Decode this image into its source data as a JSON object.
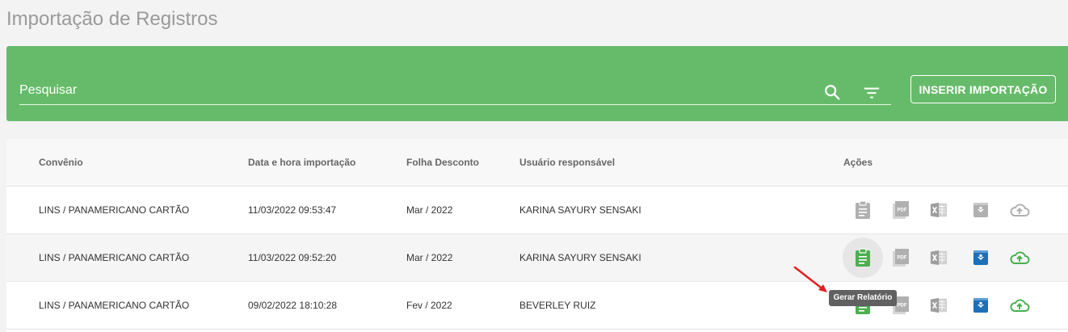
{
  "page": {
    "title": "Importação de Registros"
  },
  "toolbar": {
    "search_placeholder": "Pesquisar",
    "insert_label": "INSERIR IMPORTAÇÃO"
  },
  "table": {
    "headers": {
      "convenio": "Convênio",
      "data_hora": "Data e hora importação",
      "folha": "Folha Desconto",
      "usuario": "Usuário responsável",
      "acoes": "Ações"
    },
    "rows": [
      {
        "convenio": "LINS / PANAMERICANO CARTÃO",
        "data_hora": "11/03/2022 09:53:47",
        "folha": "Mar / 2022",
        "usuario": "KARINA SAYURY SENSAKI"
      },
      {
        "convenio": "LINS / PANAMERICANO CARTÃO",
        "data_hora": "11/03/2022 09:52:20",
        "folha": "Mar / 2022",
        "usuario": "KARINA SAYURY SENSAKI"
      },
      {
        "convenio": "LINS / PANAMERICANO CARTÃO",
        "data_hora": "09/02/2022 18:10:28",
        "folha": "Fev / 2022",
        "usuario": "BEVERLEY RUIZ"
      }
    ]
  },
  "tooltip": {
    "text": "Gerar Relatório"
  },
  "icons": {
    "report": "clipboard-icon",
    "pdf": "pdf-icon",
    "excel": "excel-icon",
    "download": "download-box-icon",
    "upload": "cloud-upload-icon"
  },
  "colors": {
    "toolbar_bg": "#66bb6a",
    "active_green": "#4caf50",
    "active_blue": "#1e6fb8",
    "disabled_gray": "#b0b0b0",
    "tooltip_bg": "#616161"
  }
}
